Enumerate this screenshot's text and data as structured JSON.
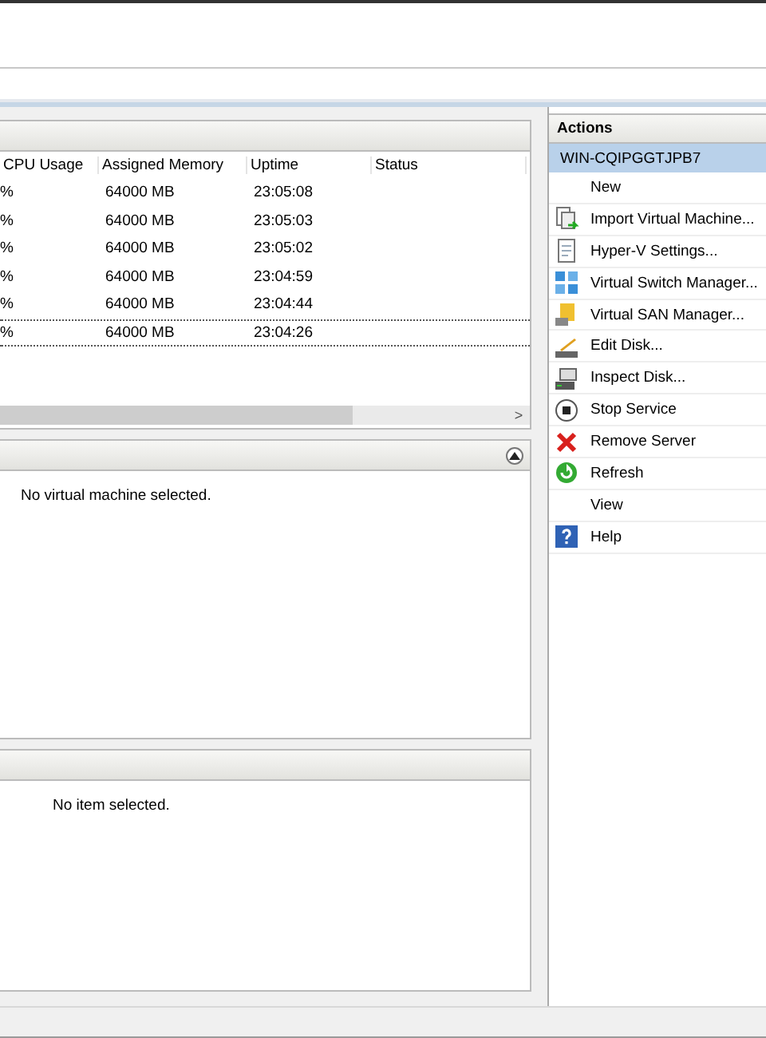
{
  "vm_table": {
    "columns": [
      "CPU Usage",
      "Assigned Memory",
      "Uptime",
      "Status"
    ],
    "rows": [
      {
        "cells": [
          "%",
          "64000 MB",
          "23:05:08"
        ],
        "focused": false
      },
      {
        "cells": [
          "%",
          "64000 MB",
          "23:05:03"
        ],
        "focused": false
      },
      {
        "cells": [
          "%",
          "64000 MB",
          "23:05:02"
        ],
        "focused": false
      },
      {
        "cells": [
          "%",
          "64000 MB",
          "23:04:59"
        ],
        "focused": false
      },
      {
        "cells": [
          "%",
          "64000 MB",
          "23:04:44"
        ],
        "focused": false
      },
      {
        "cells": [
          "%",
          "64000 MB",
          "23:04:26"
        ],
        "focused": true
      }
    ],
    "scroll_arrow": ">"
  },
  "details_panel": {
    "message": "No virtual machine selected.",
    "expanded": true
  },
  "bottom_panel": {
    "message": "No item selected."
  },
  "actions": {
    "title": "Actions",
    "server": "WIN-CQIPGGTJPB7",
    "items": [
      "New",
      "Import Virtual Machine...",
      "Hyper-V Settings...",
      "Virtual Switch Manager...",
      "Virtual SAN Manager...",
      "Edit Disk...",
      "Inspect Disk...",
      "Stop Service",
      "Remove Server",
      "Refresh",
      "View",
      "Help"
    ]
  }
}
